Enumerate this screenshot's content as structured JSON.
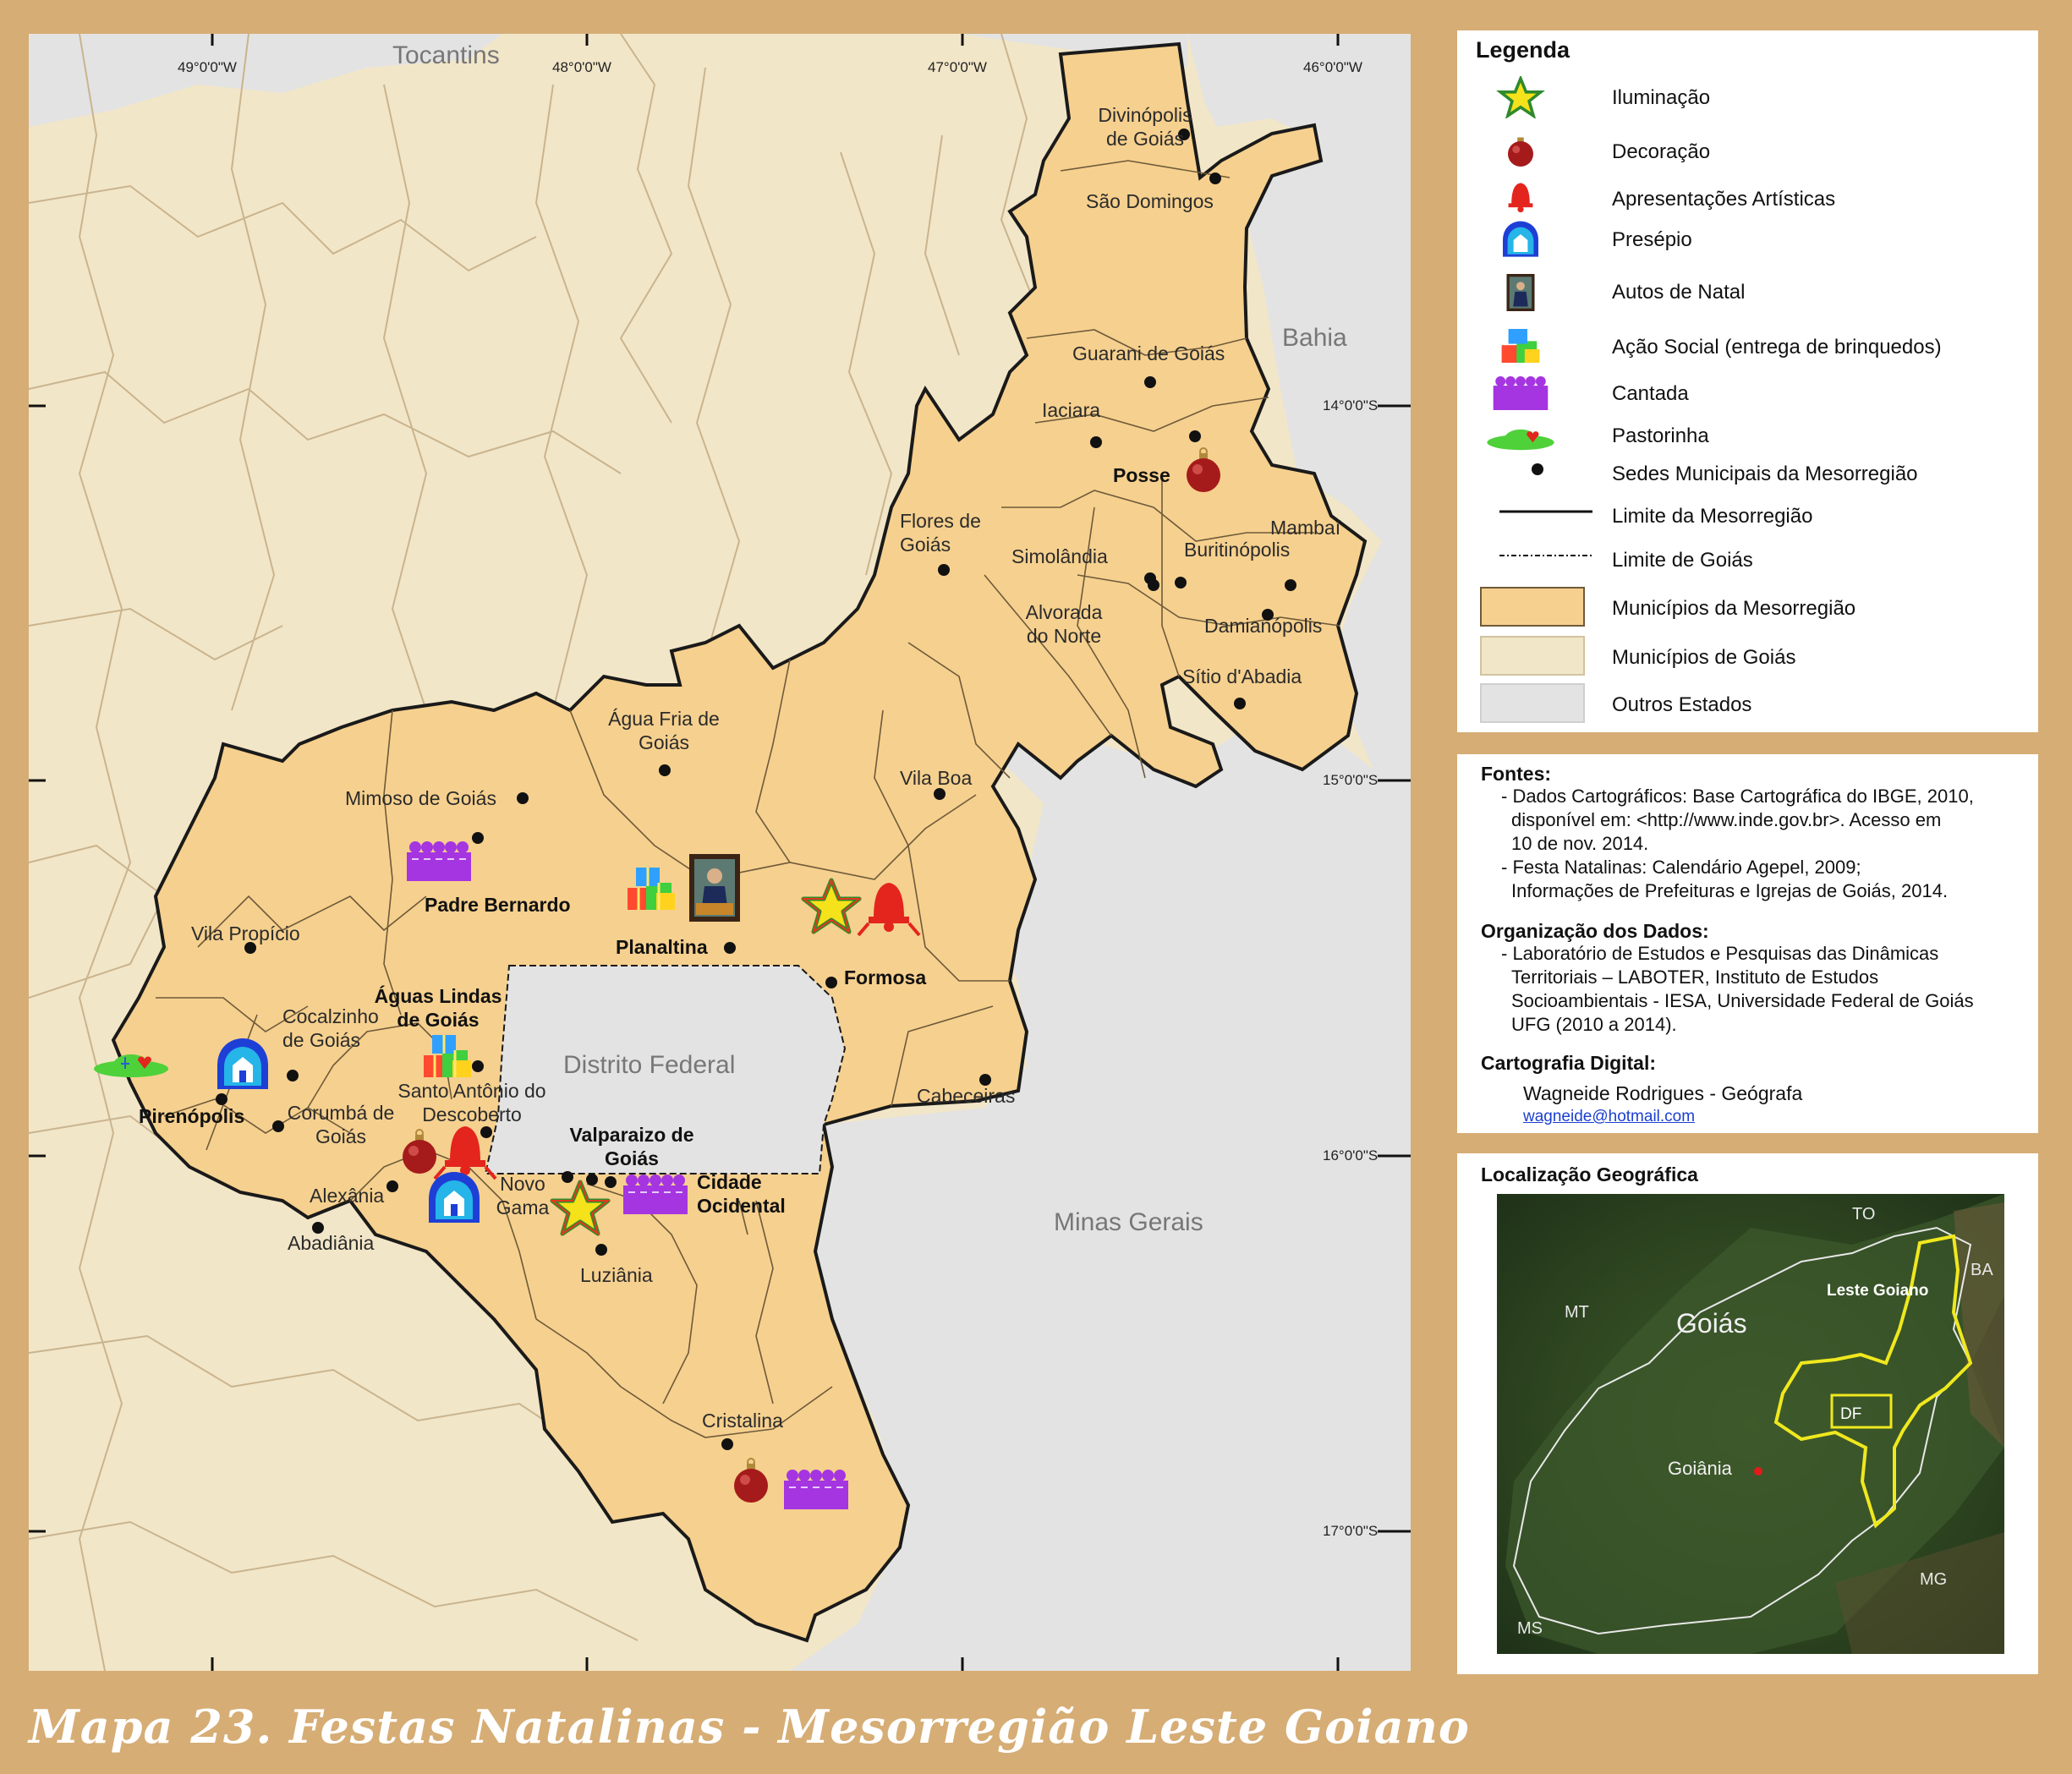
{
  "title": "Mapa 23. Festas Natalinas - Mesorregião Leste Goiano",
  "map": {
    "longitudes": [
      "49°0'0\"W",
      "48°0'0\"W",
      "47°0'0\"W",
      "46°0'0\"W"
    ],
    "latitudes": [
      "14°0'0\"S",
      "15°0'0\"S",
      "16°0'0\"S",
      "17°0'0\"S"
    ],
    "states": [
      "Tocantins",
      "Bahia",
      "Distrito Federal",
      "Minas Gerais"
    ],
    "municipalities": [
      "Divinópolis de Goiás",
      "São Domingos",
      "Guarani de Goiás",
      "Iaciara",
      "Posse",
      "Flores de Goiás",
      "Simolândia",
      "Mambaí",
      "Buritinópolis",
      "Alvorada do Norte",
      "Damianópolis",
      "Sítio d'Abadia",
      "Água Fria de Goiás",
      "Mimoso de Goiás",
      "Vila Boa",
      "Padre Bernardo",
      "Planaltina",
      "Formosa",
      "Vila Propício",
      "Águas Lindas de Goiás",
      "Cocalzinho de Goiás",
      "Santo Antônio do Descoberto",
      "Pirenópolis",
      "Corumbá de Goiás",
      "Cabeceiras",
      "Valparaizo de Goiás",
      "Cidade Ocidental",
      "Alexânia",
      "Novo Gama",
      "Abadiânia",
      "Luziânia",
      "Cristalina"
    ]
  },
  "legend": {
    "title": "Legenda",
    "items": [
      "Iluminação",
      "Decoração",
      "Apresentações Artísticas",
      "Presépio",
      "Autos de Natal",
      "Ação Social (entrega de brinquedos)",
      "Cantada",
      "Pastorinha",
      "Sedes Municipais da Mesorregião",
      "Limite da Mesorregião",
      "Limite de Goiás",
      "Municípios da Mesorregião",
      "Municípios de Goiás",
      "Outros Estados"
    ]
  },
  "sources": {
    "fontes_title": "Fontes:",
    "fontes_lines": [
      "- Dados Cartográficos: Base Cartográfica do IBGE, 2010,",
      "disponível em: <http://www.inde.gov.br>.  Acesso em",
      "10 de nov. 2014.",
      "- Festa Natalinas: Calendário Agepel, 2009;",
      "Informações de Prefeituras e Igrejas de Goiás, 2014."
    ],
    "org_title": "Organização dos Dados:",
    "org_lines": [
      "- Laboratório de Estudos e Pesquisas das  Dinâmicas",
      "Territoriais – LABOTER, Instituto de Estudos",
      "Socioambientais - IESA, Universidade Federal de Goiás",
      "UFG (2010 a 2014)."
    ],
    "carto_title": "Cartografia Digital:",
    "carto_name": "Wagneide Rodrigues - Geógrafa",
    "carto_email": "wagneide@hotmail.com"
  },
  "location": {
    "title": "Localização Geográfica",
    "labels": [
      "TO",
      "BA",
      "MT",
      "Goiás",
      "Leste Goiano",
      "DF",
      "Goiânia",
      "MG",
      "MS"
    ]
  },
  "colors": {
    "frame": "#d6ad75",
    "mesoregion": "#f6d08e",
    "goias": "#f2e6c8",
    "other_states": "#e3e3e3"
  }
}
